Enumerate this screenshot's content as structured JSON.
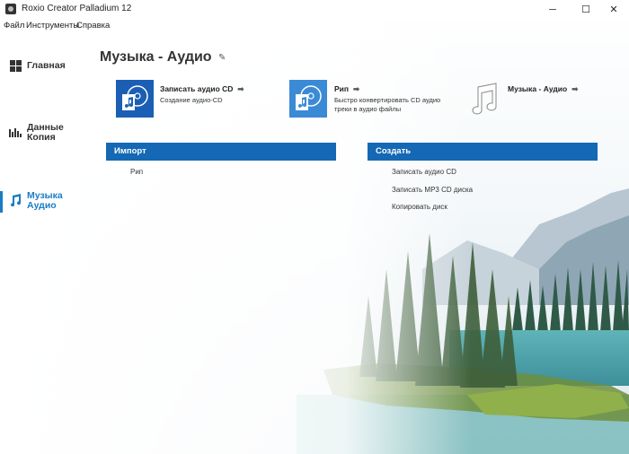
{
  "window": {
    "title": "Roxio Creator Palladium 12",
    "minimize": "─",
    "maximize": "☐",
    "close": "✕"
  },
  "menu": [
    "Файл",
    "Инструменты",
    "Справка"
  ],
  "sidebar": {
    "items": [
      {
        "label": "Главная",
        "icon": "grid-icon"
      },
      {
        "label": "Данные\nКопия",
        "icon": "bar-chart-icon"
      },
      {
        "label": "Музыка\nАудио",
        "icon": "music-note-icon",
        "active": true
      }
    ]
  },
  "page": {
    "title": "Музыка - Аудио",
    "pin": "✎"
  },
  "tiles": [
    {
      "title": "Записать аудио CD",
      "desc": "Создание аудио-CD",
      "arrow": "➡"
    },
    {
      "title": "Рип",
      "desc": "Быстро конвертировать CD аудио треки в аудио файлы",
      "arrow": "➡"
    },
    {
      "title": "Музыка - Аудио",
      "desc": "",
      "arrow": "➡"
    }
  ],
  "sections": {
    "import": {
      "header": "Импорт",
      "links": [
        "Рип"
      ]
    },
    "create": {
      "header": "Создать",
      "links": [
        "Записать аудио CD",
        "Записать MP3 CD диска",
        "Копировать диск"
      ]
    }
  },
  "colors": {
    "accent": "#1468b4",
    "active": "#1a7cc4"
  }
}
